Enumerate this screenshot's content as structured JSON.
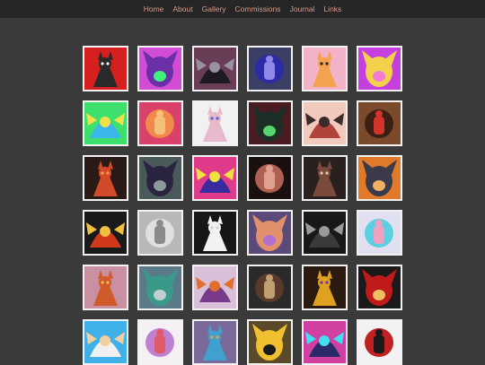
{
  "nav": {
    "items": [
      "Home",
      "About",
      "Gallery",
      "Commissions",
      "Journal",
      "Links"
    ]
  },
  "gallery": {
    "thumbnails": [
      {
        "bg": "#d61f1f",
        "fg": "#2a2a2a",
        "ac": "#f3f3f3"
      },
      {
        "bg": "#d24cd6",
        "fg": "#6b2fa8",
        "ac": "#3ef27c"
      },
      {
        "bg": "#6a3d56",
        "fg": "#1d1a24",
        "ac": "#9a8fa3"
      },
      {
        "bg": "#3b3f66",
        "fg": "#2c2aa6",
        "ac": "#8e88e6"
      },
      {
        "bg": "#f2b3c8",
        "fg": "#f3a24e",
        "ac": "#242424"
      },
      {
        "bg": "#c53fe0",
        "fg": "#f2d24a",
        "ac": "#f07cd8"
      },
      {
        "bg": "#3ee06d",
        "fg": "#3ab7e8",
        "ac": "#f2e04a"
      },
      {
        "bg": "#d9406a",
        "fg": "#f08a4a",
        "ac": "#f5c07a"
      },
      {
        "bg": "#f1f1f1",
        "fg": "#e8b9cc",
        "ac": "#4a66e0"
      },
      {
        "bg": "#4a1c22",
        "fg": "#1c2e26",
        "ac": "#58d66e"
      },
      {
        "bg": "#f2c9bd",
        "fg": "#b0443a",
        "ac": "#3a2a2a"
      },
      {
        "bg": "#7a4a2a",
        "fg": "#3b1e14",
        "ac": "#d0342a"
      },
      {
        "bg": "#2a1a16",
        "fg": "#d24a2a",
        "ac": "#f0a050"
      },
      {
        "bg": "#4a5a5a",
        "fg": "#2a2440",
        "ac": "#8a9a9a"
      },
      {
        "bg": "#e03a8a",
        "fg": "#3a2aa0",
        "ac": "#f0e040"
      },
      {
        "bg": "#1a1010",
        "fg": "#b06050",
        "ac": "#e0a090"
      },
      {
        "bg": "#2a2020",
        "fg": "#7a4a3a",
        "ac": "#e0d0c0"
      },
      {
        "bg": "#e07a2a",
        "fg": "#3a3a4a",
        "ac": "#f0b060"
      },
      {
        "bg": "#1a1a1a",
        "fg": "#d03a1a",
        "ac": "#f0c040"
      },
      {
        "bg": "#b8b8b8",
        "fg": "#e0e0e0",
        "ac": "#8a8a8a"
      },
      {
        "bg": "#161616",
        "fg": "#f2f2f2",
        "ac": "#d0d0d0"
      },
      {
        "bg": "#5a4a7a",
        "fg": "#e0906a",
        "ac": "#b070d0"
      },
      {
        "bg": "#181818",
        "fg": "#3a3a3a",
        "ac": "#9a9a9a"
      },
      {
        "bg": "#e0e0f0",
        "fg": "#5ad0e0",
        "ac": "#f0a0c0"
      },
      {
        "bg": "#c890a0",
        "fg": "#d05a2a",
        "ac": "#f0c060"
      },
      {
        "bg": "#5a7a8a",
        "fg": "#3a9a8a",
        "ac": "#c0d0d0"
      },
      {
        "bg": "#d8c0d8",
        "fg": "#7a3a8a",
        "ac": "#e07030"
      },
      {
        "bg": "#2a2a2a",
        "fg": "#5a3a2a",
        "ac": "#c0a070"
      },
      {
        "bg": "#2a1a10",
        "fg": "#e0a020",
        "ac": "#6a3aa0"
      },
      {
        "bg": "#1a1a1a",
        "fg": "#c01a1a",
        "ac": "#f0c060"
      },
      {
        "bg": "#40b0e8",
        "fg": "#f0f0f0",
        "ac": "#f0d0a0"
      },
      {
        "bg": "#f4f0f4",
        "fg": "#c080d0",
        "ac": "#e05a6a"
      },
      {
        "bg": "#7a6a9a",
        "fg": "#40a0d0",
        "ac": "#f0a030"
      },
      {
        "bg": "#5a4a2a",
        "fg": "#f0c030",
        "ac": "#1a1a1a"
      },
      {
        "bg": "#d040a0",
        "fg": "#2a2a6a",
        "ac": "#40e0f0"
      },
      {
        "bg": "#f2f2f2",
        "fg": "#c02020",
        "ac": "#1a1a1a"
      }
    ]
  }
}
